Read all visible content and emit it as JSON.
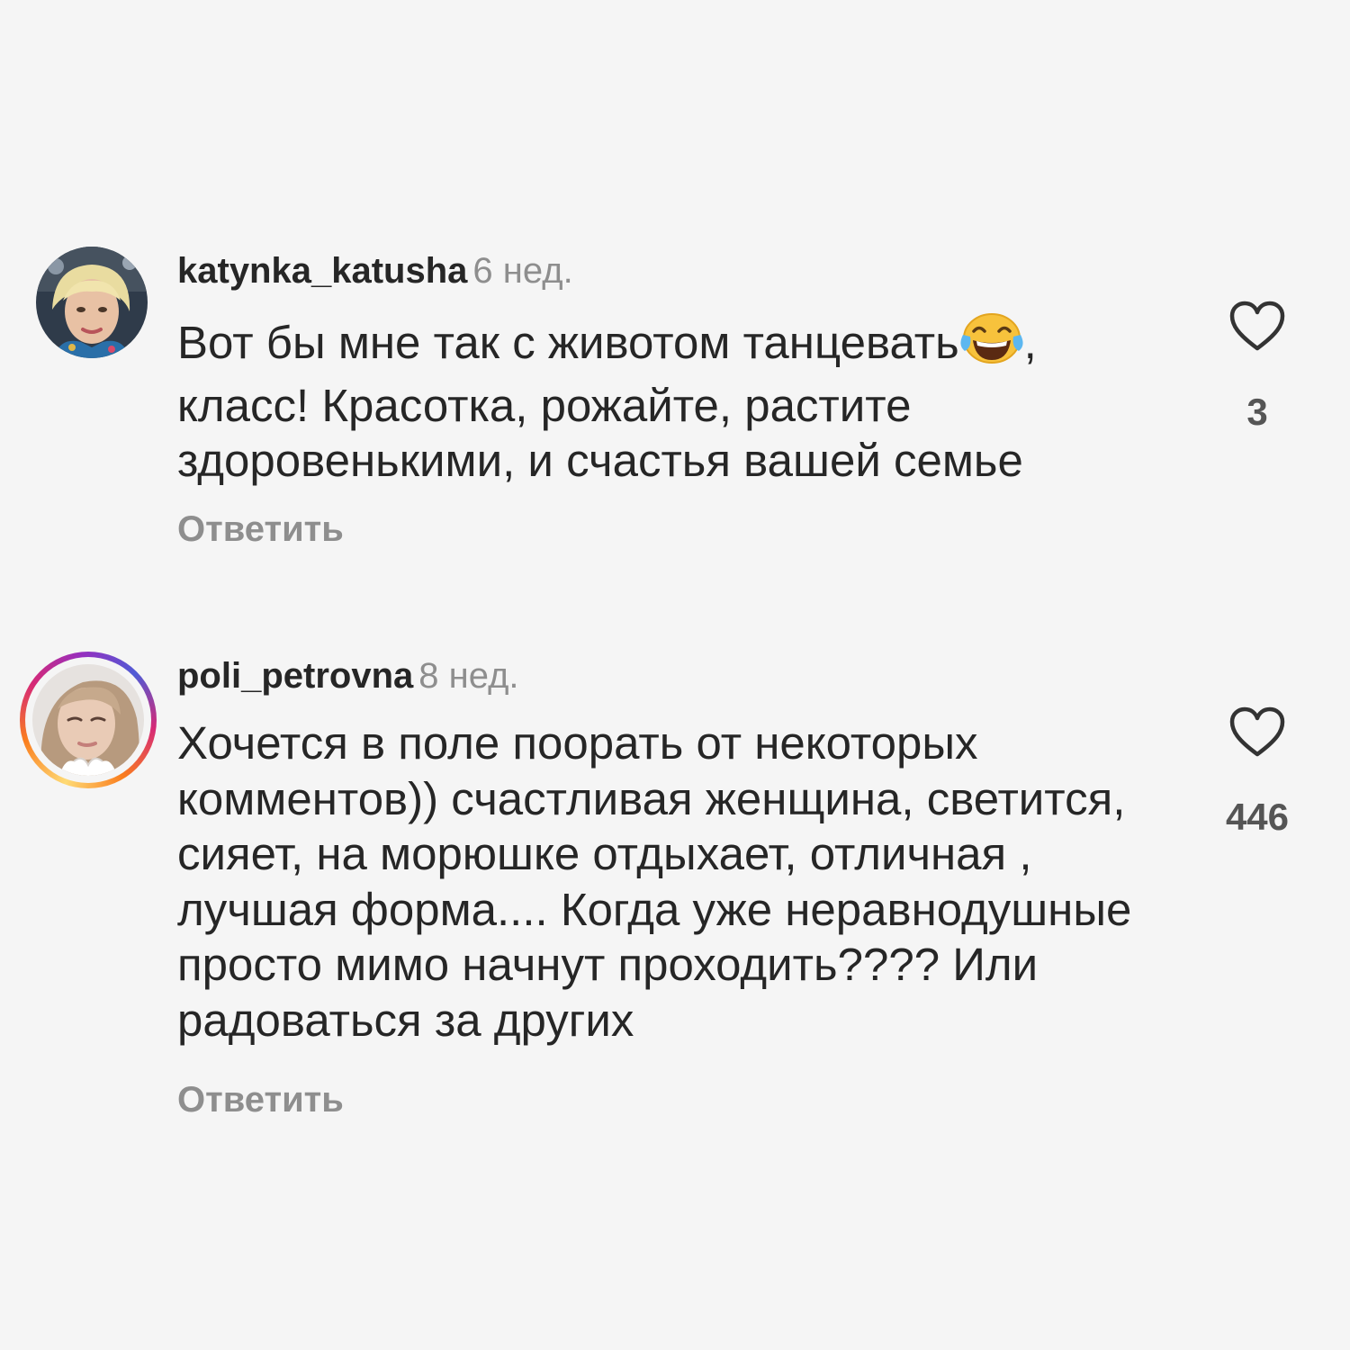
{
  "comments": [
    {
      "username": "katynka_katusha",
      "time": "6 нед.",
      "text_before_emoji": "Вот бы мне так с животом танцевать",
      "text_after_emoji": ", класс! Красотка, рожайте, растите здоровенькими, и счастья вашей семье",
      "emoji": "face-with-tears-of-joy",
      "likes": "3",
      "reply_label": "Ответить",
      "has_story_ring": false
    },
    {
      "username": "poli_petrovna",
      "time": "8 нед.",
      "text": "Хочется в поле поорать от некоторых комментов)) счастливая женщина, светится, сияет, на морюшке отдыхает, отличная , лучшая форма.... Когда уже неравнодушные просто мимо начнут проходить???? Или радоваться за других",
      "likes": "446",
      "reply_label": "Ответить",
      "has_story_ring": true
    }
  ],
  "colors": {
    "background": "#f5f5f5",
    "primary_text": "#262626",
    "secondary_text": "#8e8e8e"
  }
}
